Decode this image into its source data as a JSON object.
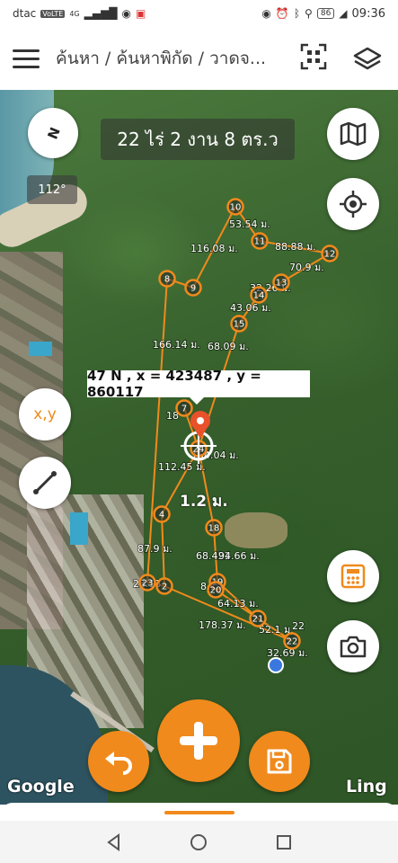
{
  "status_bar": {
    "carrier": "dtac",
    "volte": "VoLTE",
    "network": "4G",
    "battery": "86",
    "time": "09:36"
  },
  "app_bar": {
    "breadcrumb": "ค้นหา / ค้นหาพิกัด / วาดจ..."
  },
  "map": {
    "compass_label": "N",
    "bearing": "112°",
    "area_text": "22 ไร่ 2 งาน 8 ตร.ว",
    "coordinate_readout": "47 N , x = 423487 , y = 860117",
    "xy_button_label": "x,y",
    "distance_label": "1.2 ม.",
    "google_label": "Google",
    "ling_label": "Ling",
    "points": [
      {
        "id": "2"
      },
      {
        "id": "4"
      },
      {
        "id": "7"
      },
      {
        "id": "8"
      },
      {
        "id": "9"
      },
      {
        "id": "10"
      },
      {
        "id": "11"
      },
      {
        "id": "12"
      },
      {
        "id": "13"
      },
      {
        "id": "14"
      },
      {
        "id": "15"
      },
      {
        "id": "18"
      },
      {
        "id": "19"
      },
      {
        "id": "20"
      },
      {
        "id": "21"
      },
      {
        "id": "22"
      },
      {
        "id": "23"
      },
      {
        "id": "24"
      }
    ],
    "segment_labels": [
      "53.54 ม.",
      "116.08 ม.",
      "88.88 ม.",
      "70.9 ม.",
      "32.26 ม.",
      "43.06 ม.",
      "166.14 ม.",
      "68.09 ม.",
      "18",
      "154.04 ม.",
      "112.45 ม.",
      "87.9 ม.",
      "68.421",
      "94.66 ม.",
      "8.19",
      "64.13 ม.",
      "178.37 ม.",
      "52.1 ม.",
      "32.69 ม.",
      "23.13",
      "22"
    ]
  },
  "colors": {
    "accent": "#f08a1c",
    "line": "#f08a1c",
    "marker_active": "#e8512a",
    "gps_dot": "#3a78e0"
  }
}
